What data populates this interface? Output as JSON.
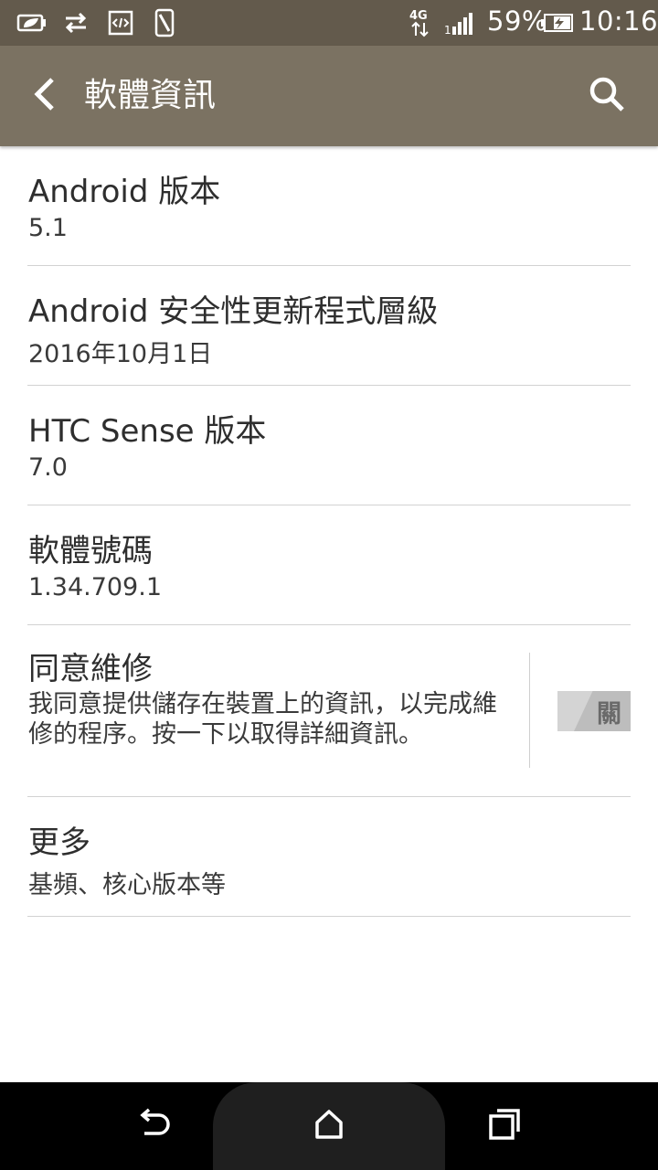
{
  "status_bar": {
    "network": "4G",
    "battery": "59%",
    "time": "10:16"
  },
  "app_bar": {
    "title": "軟體資訊"
  },
  "items": [
    {
      "title": "Android 版本",
      "subtitle": "5.1"
    },
    {
      "title": "Android 安全性更新程式層級",
      "subtitle": "2016年10月1日"
    },
    {
      "title": "HTC Sense 版本",
      "subtitle": "7.0"
    },
    {
      "title": "軟體號碼",
      "subtitle": "1.34.709.1"
    },
    {
      "title": "同意維修",
      "description": "我同意提供儲存在裝置上的資訊，以完成維修的程序。按一下以取得詳細資訊。",
      "toggle_label": "關",
      "toggle_state": "off"
    },
    {
      "title": "更多",
      "subtitle": "基頻、核心版本等"
    }
  ],
  "icons": {
    "status_left": [
      "leaf-battery-saver-icon",
      "sync-arrows-icon",
      "developer-code-icon",
      "screenshot-icon"
    ],
    "status_right": [
      "network-4g-icon",
      "signal-bars-icon",
      "battery-charging-icon"
    ],
    "app_bar": [
      "back-arrow-icon",
      "search-icon"
    ],
    "nav": [
      "nav-back-icon",
      "nav-home-icon",
      "nav-recents-icon"
    ]
  },
  "colors": {
    "status_bar": "#635a4c",
    "app_bar": "#7b7262",
    "divider": "#d2d2d2",
    "nav_bar": "#000000"
  }
}
